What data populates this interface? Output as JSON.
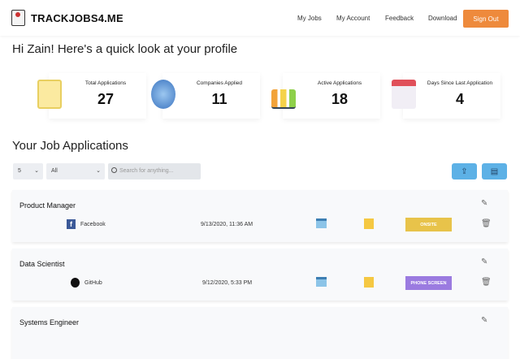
{
  "nav": {
    "brand": "TRACKJOBS4.ME",
    "links": [
      "My Jobs",
      "My Account",
      "Feedback",
      "Download"
    ],
    "signout": "Sign Out"
  },
  "greeting": "Hi Zain! Here's a quick look at your profile",
  "stats": [
    {
      "label": "Total Applications",
      "value": "27",
      "icon": "resume-icon"
    },
    {
      "label": "Companies Applied",
      "value": "11",
      "icon": "building-icon"
    },
    {
      "label": "Active Applications",
      "value": "18",
      "icon": "growth-chart-icon"
    },
    {
      "label": "Days Since Last Application",
      "value": "4",
      "icon": "calendar-icon"
    }
  ],
  "section_title": "Your Job Applications",
  "controls": {
    "page_size": "5",
    "filter": "All",
    "search_placeholder": "Search for anything..."
  },
  "jobs": [
    {
      "title": "Product Manager",
      "company": "Facebook",
      "date": "9/13/2020, 11:36 AM",
      "status": "ONSITE",
      "status_color": "#e8c34a"
    },
    {
      "title": "Data Scientist",
      "company": "GitHub",
      "date": "9/12/2020, 5:33 PM",
      "status": "PHONE SCREEN",
      "status_color": "#9b7be0"
    },
    {
      "title": "Systems Engineer"
    }
  ],
  "colors": {
    "accent": "#ee8a3c",
    "toolbar": "#5db1e6"
  }
}
